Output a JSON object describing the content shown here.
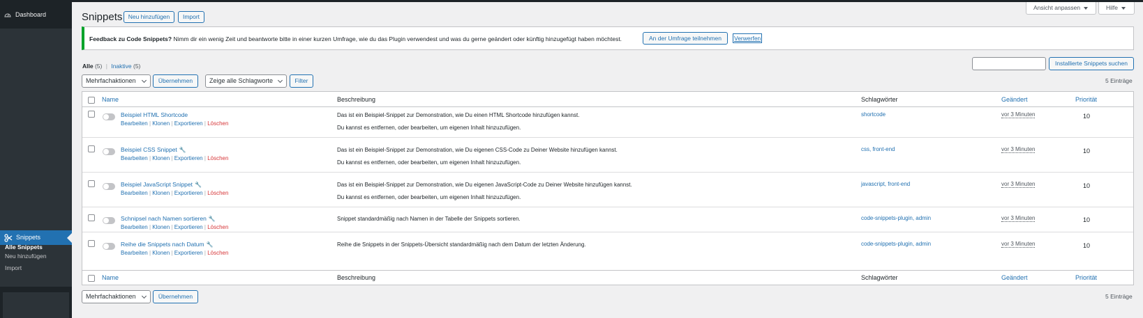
{
  "sidebar": {
    "dashboard_label": "Dashboard",
    "current_menu_label": "Snippets",
    "submenu": [
      "Alle Snippets",
      "Neu hinzufügen",
      "Import"
    ]
  },
  "screen_options": {
    "label": "Ansicht anpassen"
  },
  "help": {
    "label": "Hilfe"
  },
  "page": {
    "title": "Snippets",
    "add_new_label": "Neu hinzufügen",
    "import_label": "Import"
  },
  "notice": {
    "bold_text": "Feedback zu Code Snippets?",
    "text": "Nimm dir ein wenig Zeit und beantworte bitte in einer kurzen Umfrage, wie du das Plugin verwendest und was du gerne geändert oder künftig hinzugefügt haben möchtest.",
    "survey_button": "An der Umfrage teilnehmen",
    "dismiss_button": "Verwerfen"
  },
  "filters": {
    "all_label": "Alle",
    "all_count": "(5)",
    "separator": "|",
    "inactive_label": "Inaktive",
    "inactive_count": "(5)"
  },
  "search": {
    "button_label": "Installierte Snippets suchen",
    "value": ""
  },
  "bulk": {
    "select_value": "Mehrfachaktionen",
    "apply_label": "Übernehmen",
    "tags_select_value": "Zeige alle Schlagworte",
    "filter_label": "Filter",
    "items_count": "5 Einträge"
  },
  "table": {
    "columns": {
      "name": "Name",
      "description": "Beschreibung",
      "tags": "Schlagwörter",
      "modified": "Geändert",
      "priority": "Priorität"
    },
    "actions": {
      "edit": "Bearbeiten",
      "clone": "Klonen",
      "export": "Exportieren",
      "delete": "Löschen",
      "separator": "|"
    },
    "rows": [
      {
        "name": "Beispiel HTML Shortcode",
        "desc1": "Das ist ein Beispiel-Snippet zur Demonstration, wie Du einen HTML Shortcode hinzufügen kannst.",
        "desc2": "Du kannst es entfernen, oder bearbeiten, um eigenen Inhalt hinzuzufügen.",
        "tags": "shortcode",
        "modified": "vor 3 Minuten",
        "priority": "10",
        "wrench": ""
      },
      {
        "name": "Beispiel CSS Snippet",
        "desc1": "Das ist ein Beispiel-Snippet zur Demonstration, wie Du eigenen CSS-Code zu Deiner Website hinzufügen kannst.",
        "desc2": "Du kannst es entfernen, oder bearbeiten, um eigenen Inhalt hinzuzufügen.",
        "tags": "css, front-end",
        "modified": "vor 3 Minuten",
        "priority": "10",
        "wrench": "🔧"
      },
      {
        "name": "Beispiel JavaScript Snippet",
        "desc1": "Das ist ein Beispiel-Snippet zur Demonstration, wie Du eigenen JavaScript-Code zu Deiner Website hinzufügen kannst.",
        "desc2": "Du kannst es entfernen, oder bearbeiten, um eigenen Inhalt hinzuzufügen.",
        "tags": "javascript, front-end",
        "modified": "vor 3 Minuten",
        "priority": "10",
        "wrench": "🔧"
      },
      {
        "name": "Schnipsel nach Namen sortieren",
        "desc1": "Snippet standardmäßig nach Namen in der Tabelle der Snippets sortieren.",
        "desc2": "",
        "tags": "code-snippets-plugin, admin",
        "modified": "vor 3 Minuten",
        "priority": "10",
        "wrench": "🔧"
      },
      {
        "name": "Reihe die Snippets nach Datum",
        "desc1": "Reihe die Snippets in der Snippets-Übersicht standardmäßig nach dem Datum der letzten Änderung.",
        "desc2": "",
        "tags": "code-snippets-plugin, admin",
        "modified": "vor 3 Minuten",
        "priority": "10",
        "wrench": "🔧"
      }
    ]
  },
  "colors": {
    "accent": "#2271b1",
    "sidebar_bg": "#1d2327",
    "notice_border": "#00a32a",
    "delete": "#d63638"
  }
}
